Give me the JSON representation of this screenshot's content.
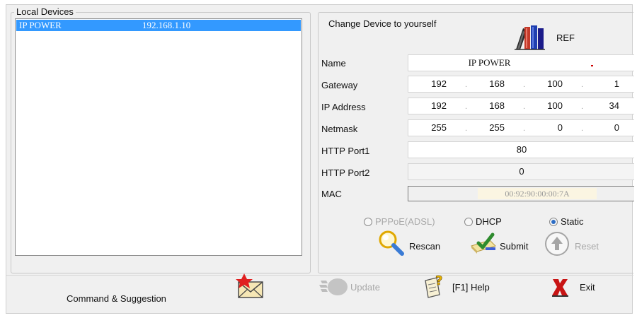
{
  "local_devices": {
    "title": "Local Devices",
    "items": [
      {
        "name": "IP POWER",
        "ip": "192.168.1.10",
        "selected": true
      }
    ]
  },
  "change": {
    "title": "Change Device to yourself",
    "ref_label": "REF",
    "fields": {
      "name": {
        "label": "Name",
        "value": "IP POWER"
      },
      "gateway": {
        "label": "Gateway",
        "octets": [
          "192",
          "168",
          "100",
          "1"
        ]
      },
      "ip_address": {
        "label": "IP Address",
        "octets": [
          "192",
          "168",
          "100",
          "34"
        ]
      },
      "netmask": {
        "label": "Netmask",
        "octets": [
          "255",
          "255",
          "0",
          "0"
        ]
      },
      "http_port1": {
        "label": "HTTP Port1",
        "value": "80"
      },
      "http_port2": {
        "label": "HTTP Port2",
        "value": "0"
      },
      "mac": {
        "label": "MAC",
        "value": "00:92:90:00:00:7A"
      }
    },
    "mode": {
      "pppoe_label": "PPPoE(ADSL)",
      "dhcp_label": "DHCP",
      "static_label": "Static",
      "selected": "Static"
    },
    "rescan_label": "Rescan",
    "submit_label": "Submit",
    "reset_label": "Reset"
  },
  "bottom": {
    "command_label": "Command & Suggestion",
    "update_label": "Update",
    "help_label": "[F1] Help",
    "exit_label": "Exit"
  },
  "colors": {
    "selection": "#3399ff",
    "window_bg": "#f0f0f0",
    "radio_selected": "#2b6cc4"
  }
}
